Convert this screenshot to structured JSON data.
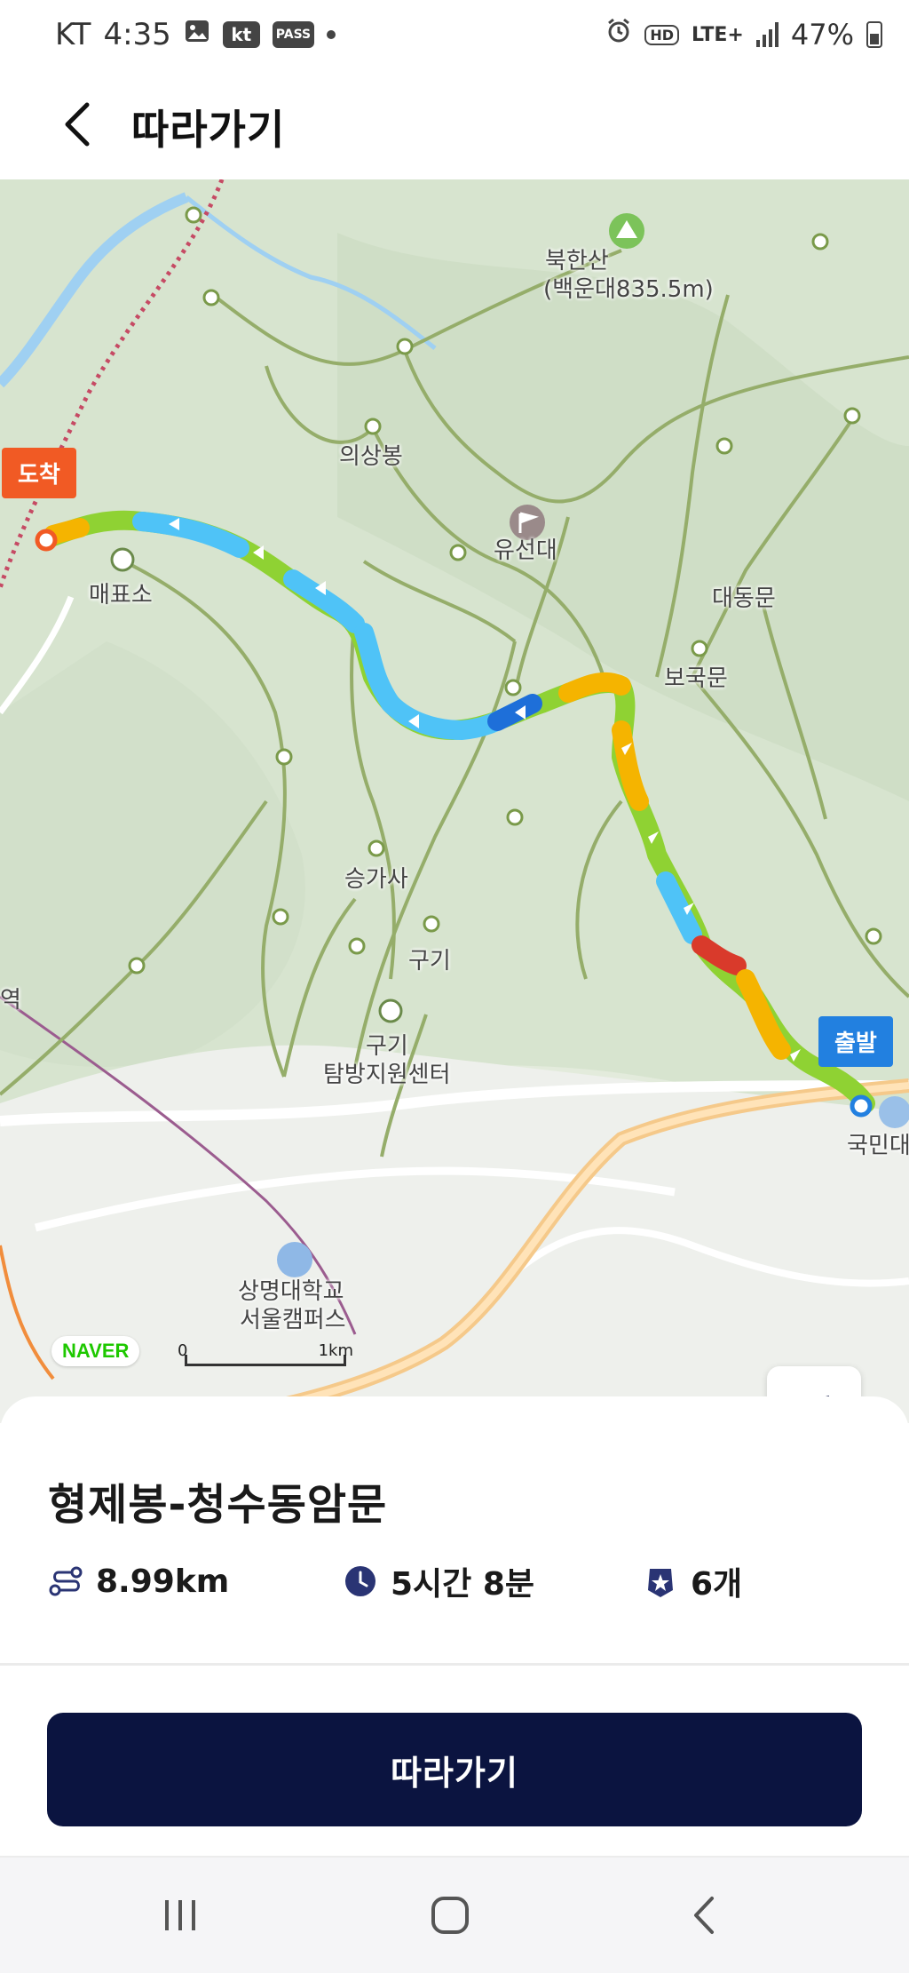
{
  "status_bar": {
    "carrier": "KT",
    "time": "4:35",
    "kt_badge": "kt",
    "pass_badge": "PASS",
    "hd": "HD",
    "network": "LTE+",
    "battery": "47%"
  },
  "header": {
    "title": "따라가기"
  },
  "map": {
    "labels": {
      "peak": "북한산",
      "peak_detail": "(백운대835.5m)",
      "uiSangBong": "의상봉",
      "yuSeonDae": "유선대",
      "ticket": "매표소",
      "daedongmun": "대동문",
      "bogukmun": "보국문",
      "seungGaSa": "승가사",
      "gugi": "구기",
      "gugi_center_line1": "구기",
      "gugi_center_line2": "탐방지원센터",
      "university_line1": "상명대학교",
      "university_line2": "서울캠퍼스",
      "station_fragment": "역",
      "kookmin_fragment": "국민대"
    },
    "end_flag": "도착",
    "start_flag": "출발",
    "naver_logo": "NAVER",
    "scale_zero": "0",
    "scale_unit": "1km",
    "colors": {
      "route_green": "#8fd233",
      "route_yellow": "#f5b400",
      "route_cyan": "#4fc3f7",
      "route_blue": "#1e6fd9",
      "route_red": "#d93a2b"
    }
  },
  "route": {
    "name": "형제봉-청수동암문",
    "distance": "8.99km",
    "duration": "5시간 8분",
    "stamps": "6개"
  },
  "actions": {
    "follow_label": "따라가기"
  },
  "colors": {
    "primary": "#0b1440",
    "stat_icon": "#2a3474"
  }
}
